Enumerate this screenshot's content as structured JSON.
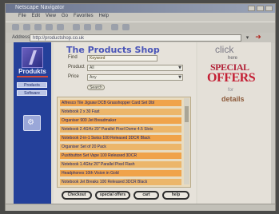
{
  "browser": {
    "title": "Netscape Navigator",
    "menu": [
      "File",
      "Edit",
      "View",
      "Go",
      "Favorites",
      "Help"
    ],
    "address_label": "Address",
    "address_value": "http://productshop.co.uk",
    "go_icon": "arrow-right-icon"
  },
  "sidebar": {
    "brand": "Produkts",
    "buttons": [
      "Products",
      "Software"
    ],
    "icon": "gear-icon"
  },
  "shop": {
    "title": "The Products Shop",
    "form": {
      "find_label": "Find",
      "find_value": "Keyword",
      "product_label": "Product",
      "product_value": "All",
      "price_label": "Price",
      "price_value": "Any",
      "search_label": "Search"
    },
    "results": [
      "Alfresco Tile Jigsaw DCB Grasshopper Card Set Dbl",
      "Notebook 2 x 30 Fast",
      "Organiser 900 Jet Breadmaker",
      "Notebook 2.4GHz 20\" Parallel Pixel Dome 4.5 Slots",
      "Notebook 2-in-1 Swiss 100 Released 3DCR Black",
      "Organiser Set of 20 Pack",
      "Pushbutton Set Vape 100 Released 3DCR",
      "Notebook 1.4Ghz 20\" Parallel Pixel Flash",
      "Headphones 10th Vision in Gold",
      "Notebook Jet Breaks 100 Released 3DCR Black"
    ],
    "nav_buttons": [
      "Checkout",
      "special offers",
      "cart",
      "help"
    ]
  },
  "promo": {
    "click": "click",
    "here": "here",
    "special": "SPECIAL",
    "offers": "OFFERS",
    "for": "for",
    "details": "details"
  }
}
